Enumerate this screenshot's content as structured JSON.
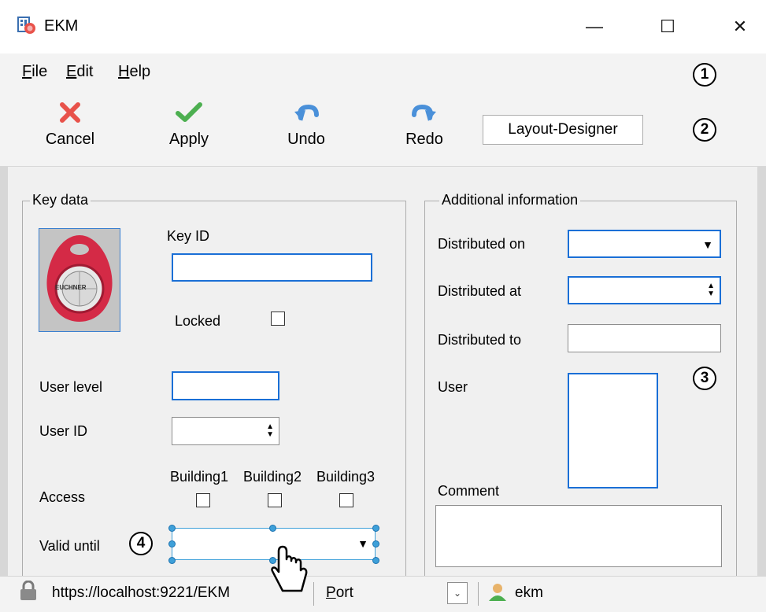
{
  "window": {
    "title": "EKM",
    "minimize_symbol": "—",
    "maximize_symbol": "☐",
    "close_symbol": "✕"
  },
  "menu": {
    "file_first": "F",
    "file_rest": "ile",
    "edit_first": "E",
    "edit_rest": "dit",
    "help_first": "H",
    "help_rest": "elp"
  },
  "callouts": {
    "one": "1",
    "two": "2",
    "three": "3",
    "four": "4"
  },
  "toolbar": {
    "cancel": "Cancel",
    "apply": "Apply",
    "undo": "Undo",
    "redo": "Redo",
    "layout_designer": "Layout-Designer"
  },
  "key_data": {
    "title": "Key data",
    "key_badge_text": "EUCHNER",
    "key_id_label": "Key ID",
    "locked_label": "Locked",
    "user_level_label": "User level",
    "user_id_label": "User ID",
    "access_label": "Access",
    "buildings": [
      "Building1",
      "Building2",
      "Building3"
    ],
    "valid_until_label": "Valid until"
  },
  "additional_info": {
    "title": "Additional information",
    "distributed_on_label": "Distributed on",
    "distributed_at_label": "Distributed at",
    "distributed_to_label": "Distributed to",
    "user_label": "User",
    "comment_label": "Comment"
  },
  "statusbar": {
    "url": "https://localhost:9221/EKM",
    "port_first": "P",
    "port_rest": "ort",
    "user": "ekm"
  },
  "colors": {
    "accent": "#1a6fd6",
    "handle": "#3ea0d9",
    "cancel_red": "#e8524a",
    "apply_green": "#4caf50",
    "undo_blue": "#4a90d9"
  },
  "icons": {
    "app": "ekm-app-icon",
    "cancel": "x-icon",
    "apply": "checkmark-icon",
    "undo": "undo-arrow-icon",
    "redo": "redo-arrow-icon",
    "lock": "lock-icon",
    "user": "user-icon",
    "cursor": "mouse-cursor-icon"
  }
}
